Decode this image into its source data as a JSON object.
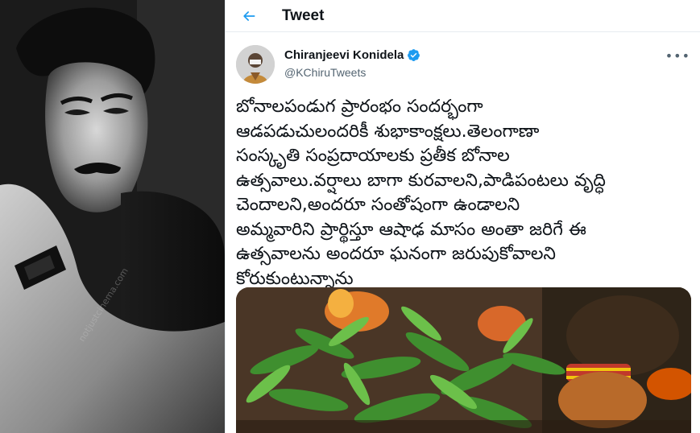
{
  "header": {
    "title": "Tweet"
  },
  "tweet": {
    "display_name": "Chiranjeevi Konidela",
    "handle": "@KChiruTweets",
    "text": "బోనాలపండుగ ప్రారంభం సందర్భంగా\nఆడపడుచులందరికీ శుభాకాంక్షలు.తెలంగాణా\nసంస్కృతి సంప్రదాయాలకు ప్రతీక బోనాల\nఉత్సవాలు.వర్షాలు బాగా కురవాలని,పాడిపంటలు వృద్ధి\nచెందాలని,అందరూ సంతోషంగా ఉండాలని\nఅమ్మవారిని ప్రార్థిస్తూ ఆషాఢ మాసం అంతా జరిగే ఈ\nఉత్సవాలను అందరూ ఘనంగా జరుపుకోవాలని\nకోరుకుంటున్నాను"
  },
  "icons": {
    "back": "arrow-left-icon",
    "verified": "verified-badge-icon",
    "more": "more-horizontal-icon"
  },
  "colors": {
    "accent": "#1d9bf0",
    "text": "#0f1419",
    "secondary": "#536471"
  },
  "portrait_watermark": "notjustcinema.com"
}
